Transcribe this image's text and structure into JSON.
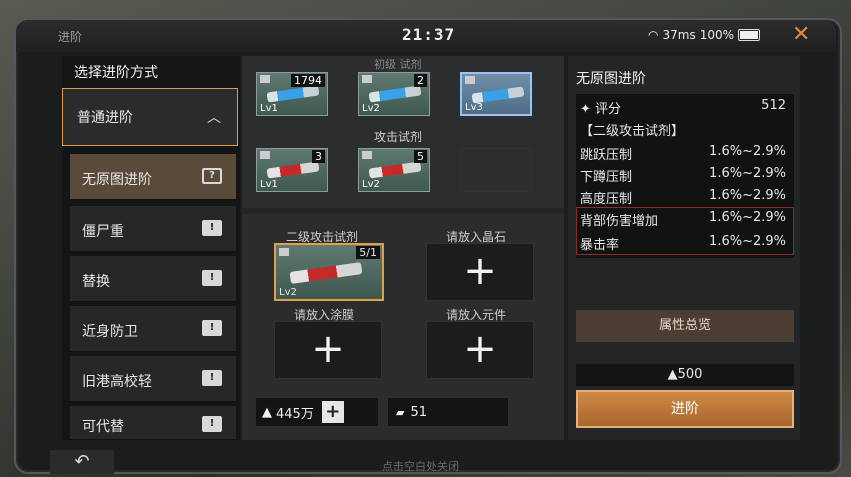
{
  "header": {
    "title": "进阶",
    "time": "21:37",
    "ping": "37ms",
    "battery": "100%"
  },
  "left": {
    "heading": "选择进阶方式",
    "mode": "普通进阶",
    "items": [
      {
        "label": "无原图进阶"
      },
      {
        "label": "僵尸重"
      },
      {
        "label": "替换"
      },
      {
        "label": "近身防卫"
      },
      {
        "label": "旧港高校轻"
      },
      {
        "label": "可代替"
      }
    ]
  },
  "middle": {
    "category_top": "初级 试剂",
    "category_attack": "攻击试剂",
    "cards_row1": [
      {
        "count": "1794",
        "level": "Lv1"
      },
      {
        "count": "2",
        "level": "Lv2"
      },
      {
        "count": "",
        "level": "Lv3"
      }
    ],
    "cards_row2": [
      {
        "count": "3",
        "level": "Lv1"
      },
      {
        "count": "5",
        "level": "Lv2"
      }
    ],
    "slot_selected_label": "二级攻击试剂",
    "slot_selected_count": "5/1",
    "slot_selected_level": "Lv2",
    "slot_crystal": "请放入晶石",
    "slot_coating": "请放入涂膜",
    "slot_component": "请放入元件",
    "gold": "445万",
    "chips": "51"
  },
  "right": {
    "heading": "无原图进阶",
    "score_label": "评分",
    "score": "512",
    "item_name": "【二级攻击试剂】",
    "stats": [
      {
        "name": "跳跃压制",
        "value": "1.6%~2.9%"
      },
      {
        "name": "下蹲压制",
        "value": "1.6%~2.9%"
      },
      {
        "name": "高度压制",
        "value": "1.6%~2.9%"
      },
      {
        "name": "背部伤害增加",
        "value": "1.6%~2.9%"
      },
      {
        "name": "暴击率",
        "value": "1.6%~2.9%"
      }
    ],
    "overview": "属性总览",
    "cost": "500",
    "advance": "进阶"
  },
  "footer": {
    "hint": "点击空白处关闭"
  }
}
